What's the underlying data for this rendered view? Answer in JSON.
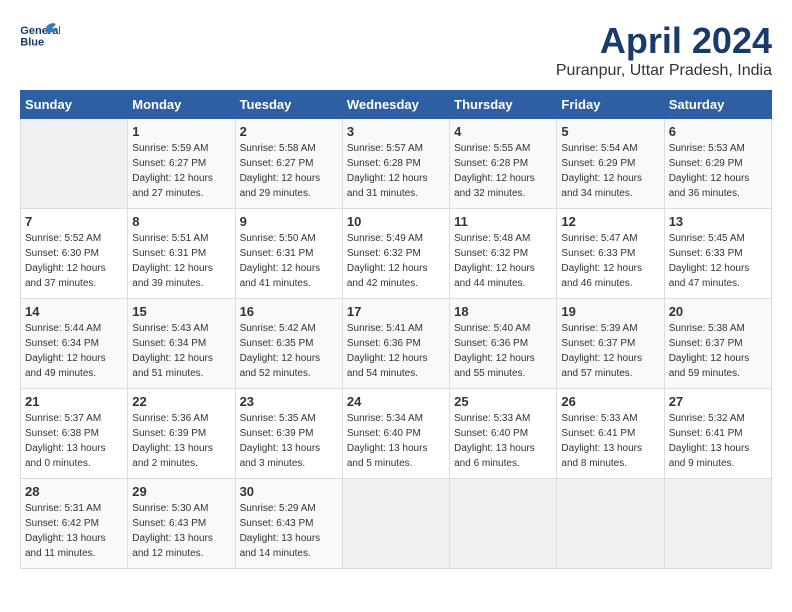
{
  "header": {
    "logo_line1": "General",
    "logo_line2": "Blue",
    "month": "April 2024",
    "location": "Puranpur, Uttar Pradesh, India"
  },
  "weekdays": [
    "Sunday",
    "Monday",
    "Tuesday",
    "Wednesday",
    "Thursday",
    "Friday",
    "Saturday"
  ],
  "weeks": [
    [
      {
        "day": "",
        "info": ""
      },
      {
        "day": "1",
        "info": "Sunrise: 5:59 AM\nSunset: 6:27 PM\nDaylight: 12 hours\nand 27 minutes."
      },
      {
        "day": "2",
        "info": "Sunrise: 5:58 AM\nSunset: 6:27 PM\nDaylight: 12 hours\nand 29 minutes."
      },
      {
        "day": "3",
        "info": "Sunrise: 5:57 AM\nSunset: 6:28 PM\nDaylight: 12 hours\nand 31 minutes."
      },
      {
        "day": "4",
        "info": "Sunrise: 5:55 AM\nSunset: 6:28 PM\nDaylight: 12 hours\nand 32 minutes."
      },
      {
        "day": "5",
        "info": "Sunrise: 5:54 AM\nSunset: 6:29 PM\nDaylight: 12 hours\nand 34 minutes."
      },
      {
        "day": "6",
        "info": "Sunrise: 5:53 AM\nSunset: 6:29 PM\nDaylight: 12 hours\nand 36 minutes."
      }
    ],
    [
      {
        "day": "7",
        "info": "Sunrise: 5:52 AM\nSunset: 6:30 PM\nDaylight: 12 hours\nand 37 minutes."
      },
      {
        "day": "8",
        "info": "Sunrise: 5:51 AM\nSunset: 6:31 PM\nDaylight: 12 hours\nand 39 minutes."
      },
      {
        "day": "9",
        "info": "Sunrise: 5:50 AM\nSunset: 6:31 PM\nDaylight: 12 hours\nand 41 minutes."
      },
      {
        "day": "10",
        "info": "Sunrise: 5:49 AM\nSunset: 6:32 PM\nDaylight: 12 hours\nand 42 minutes."
      },
      {
        "day": "11",
        "info": "Sunrise: 5:48 AM\nSunset: 6:32 PM\nDaylight: 12 hours\nand 44 minutes."
      },
      {
        "day": "12",
        "info": "Sunrise: 5:47 AM\nSunset: 6:33 PM\nDaylight: 12 hours\nand 46 minutes."
      },
      {
        "day": "13",
        "info": "Sunrise: 5:45 AM\nSunset: 6:33 PM\nDaylight: 12 hours\nand 47 minutes."
      }
    ],
    [
      {
        "day": "14",
        "info": "Sunrise: 5:44 AM\nSunset: 6:34 PM\nDaylight: 12 hours\nand 49 minutes."
      },
      {
        "day": "15",
        "info": "Sunrise: 5:43 AM\nSunset: 6:34 PM\nDaylight: 12 hours\nand 51 minutes."
      },
      {
        "day": "16",
        "info": "Sunrise: 5:42 AM\nSunset: 6:35 PM\nDaylight: 12 hours\nand 52 minutes."
      },
      {
        "day": "17",
        "info": "Sunrise: 5:41 AM\nSunset: 6:36 PM\nDaylight: 12 hours\nand 54 minutes."
      },
      {
        "day": "18",
        "info": "Sunrise: 5:40 AM\nSunset: 6:36 PM\nDaylight: 12 hours\nand 55 minutes."
      },
      {
        "day": "19",
        "info": "Sunrise: 5:39 AM\nSunset: 6:37 PM\nDaylight: 12 hours\nand 57 minutes."
      },
      {
        "day": "20",
        "info": "Sunrise: 5:38 AM\nSunset: 6:37 PM\nDaylight: 12 hours\nand 59 minutes."
      }
    ],
    [
      {
        "day": "21",
        "info": "Sunrise: 5:37 AM\nSunset: 6:38 PM\nDaylight: 13 hours\nand 0 minutes."
      },
      {
        "day": "22",
        "info": "Sunrise: 5:36 AM\nSunset: 6:39 PM\nDaylight: 13 hours\nand 2 minutes."
      },
      {
        "day": "23",
        "info": "Sunrise: 5:35 AM\nSunset: 6:39 PM\nDaylight: 13 hours\nand 3 minutes."
      },
      {
        "day": "24",
        "info": "Sunrise: 5:34 AM\nSunset: 6:40 PM\nDaylight: 13 hours\nand 5 minutes."
      },
      {
        "day": "25",
        "info": "Sunrise: 5:33 AM\nSunset: 6:40 PM\nDaylight: 13 hours\nand 6 minutes."
      },
      {
        "day": "26",
        "info": "Sunrise: 5:33 AM\nSunset: 6:41 PM\nDaylight: 13 hours\nand 8 minutes."
      },
      {
        "day": "27",
        "info": "Sunrise: 5:32 AM\nSunset: 6:41 PM\nDaylight: 13 hours\nand 9 minutes."
      }
    ],
    [
      {
        "day": "28",
        "info": "Sunrise: 5:31 AM\nSunset: 6:42 PM\nDaylight: 13 hours\nand 11 minutes."
      },
      {
        "day": "29",
        "info": "Sunrise: 5:30 AM\nSunset: 6:43 PM\nDaylight: 13 hours\nand 12 minutes."
      },
      {
        "day": "30",
        "info": "Sunrise: 5:29 AM\nSunset: 6:43 PM\nDaylight: 13 hours\nand 14 minutes."
      },
      {
        "day": "",
        "info": ""
      },
      {
        "day": "",
        "info": ""
      },
      {
        "day": "",
        "info": ""
      },
      {
        "day": "",
        "info": ""
      }
    ]
  ]
}
